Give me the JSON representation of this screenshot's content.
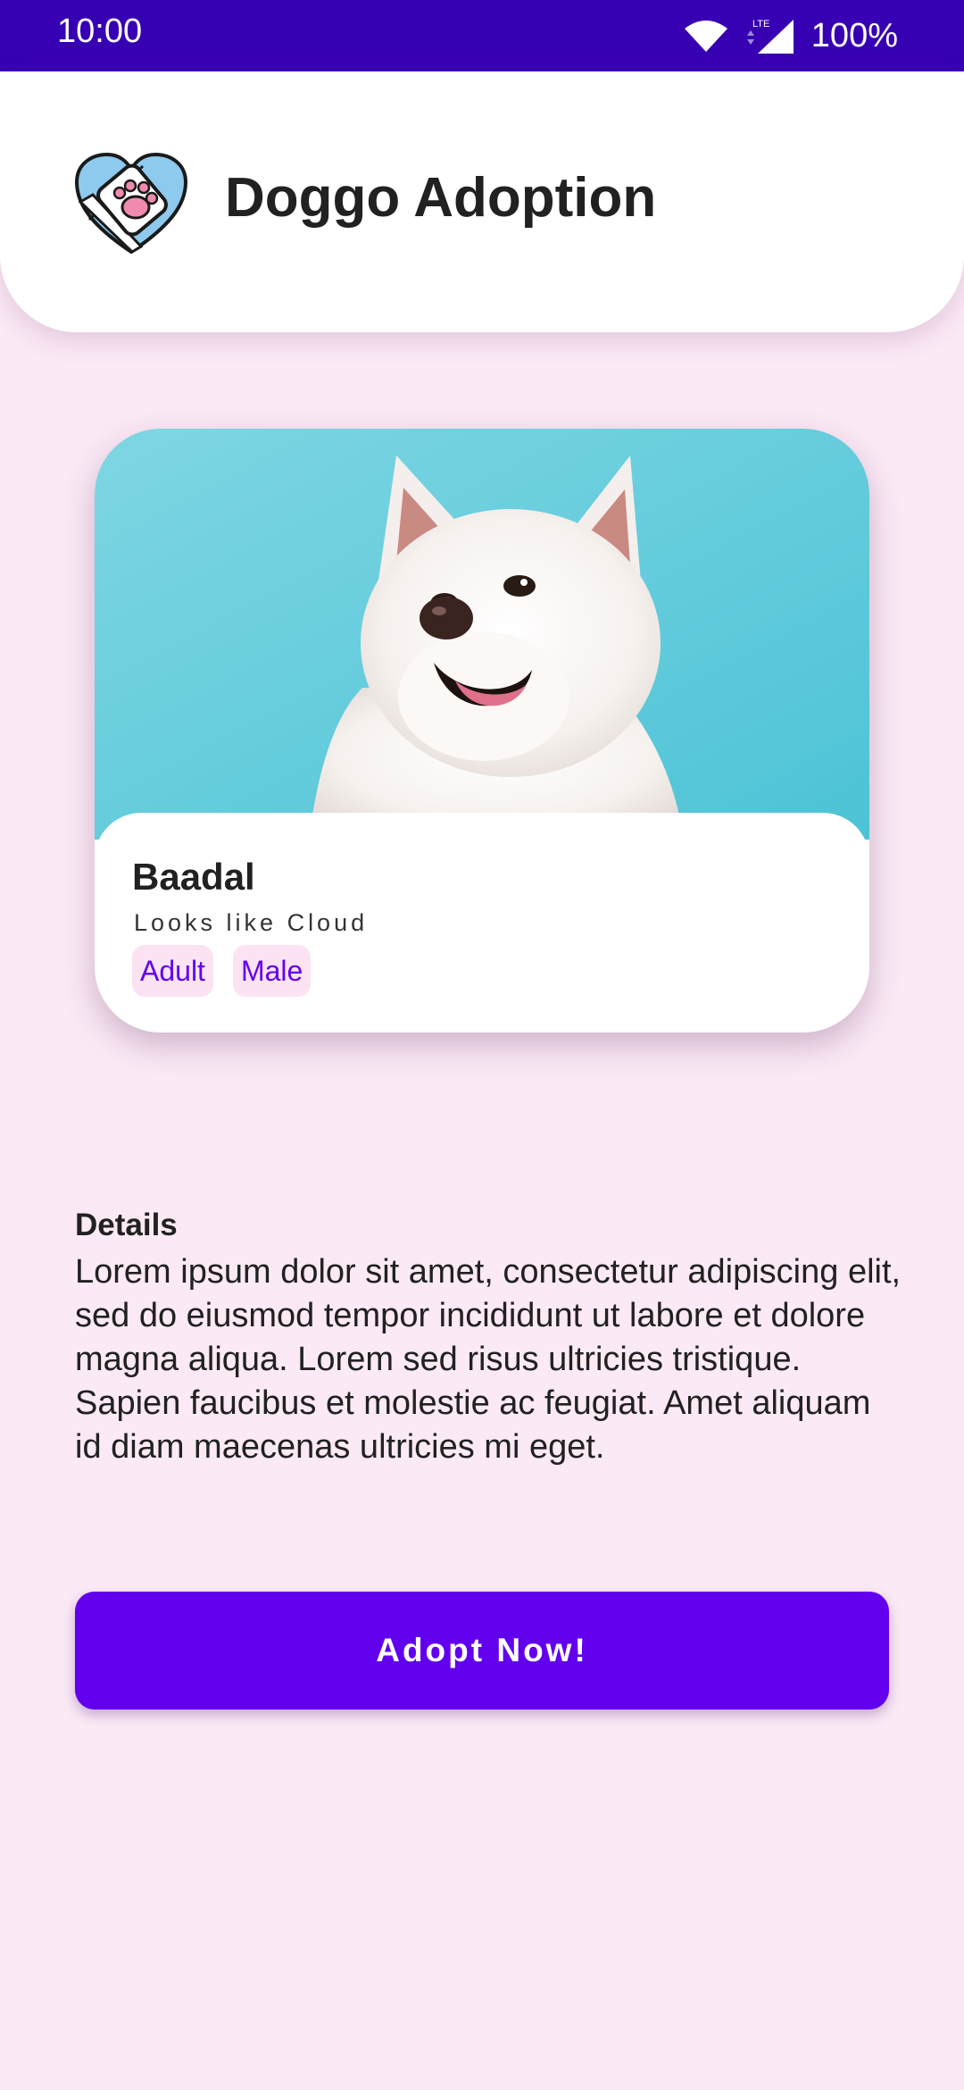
{
  "status_bar": {
    "time": "10:00",
    "battery": "100%",
    "network": "LTE"
  },
  "header": {
    "title": "Doggo Adoption",
    "logo_icon": "heart-paw-icon"
  },
  "pet": {
    "name": "Baadal",
    "description": "Looks like Cloud",
    "tags": [
      "Adult",
      "Male"
    ]
  },
  "details": {
    "label": "Details",
    "text": "Lorem ipsum dolor sit amet, consectetur adipiscing elit, sed do eiusmod tempor incididunt ut labore et dolore magna aliqua. Lorem sed risus ultricies tristique. Sapien faucibus et molestie ac feugiat. Amet aliquam id diam maecenas ultricies mi eget."
  },
  "actions": {
    "adopt_label": "Adopt Now!"
  },
  "colors": {
    "status_bar": "#3700B3",
    "primary": "#6200EE",
    "background": "#FBE9F5",
    "chip_bg": "#FBE3F3"
  }
}
